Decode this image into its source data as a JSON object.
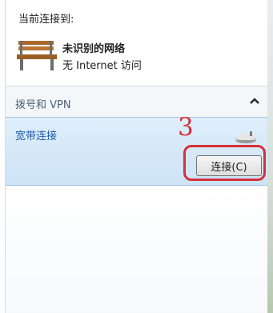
{
  "current": {
    "label": "当前连接到:"
  },
  "network": {
    "name": "未识别的网络",
    "status": "无 Internet 访问"
  },
  "dialup": {
    "title": "拨号和 VPN"
  },
  "connection": {
    "name": "宽带连接",
    "button_label": "连接(C)"
  },
  "annotation": {
    "number": "3"
  },
  "colors": {
    "annotation": "#d6303a",
    "selected_bg": "#cde3f6",
    "link": "#1d5ea8"
  }
}
